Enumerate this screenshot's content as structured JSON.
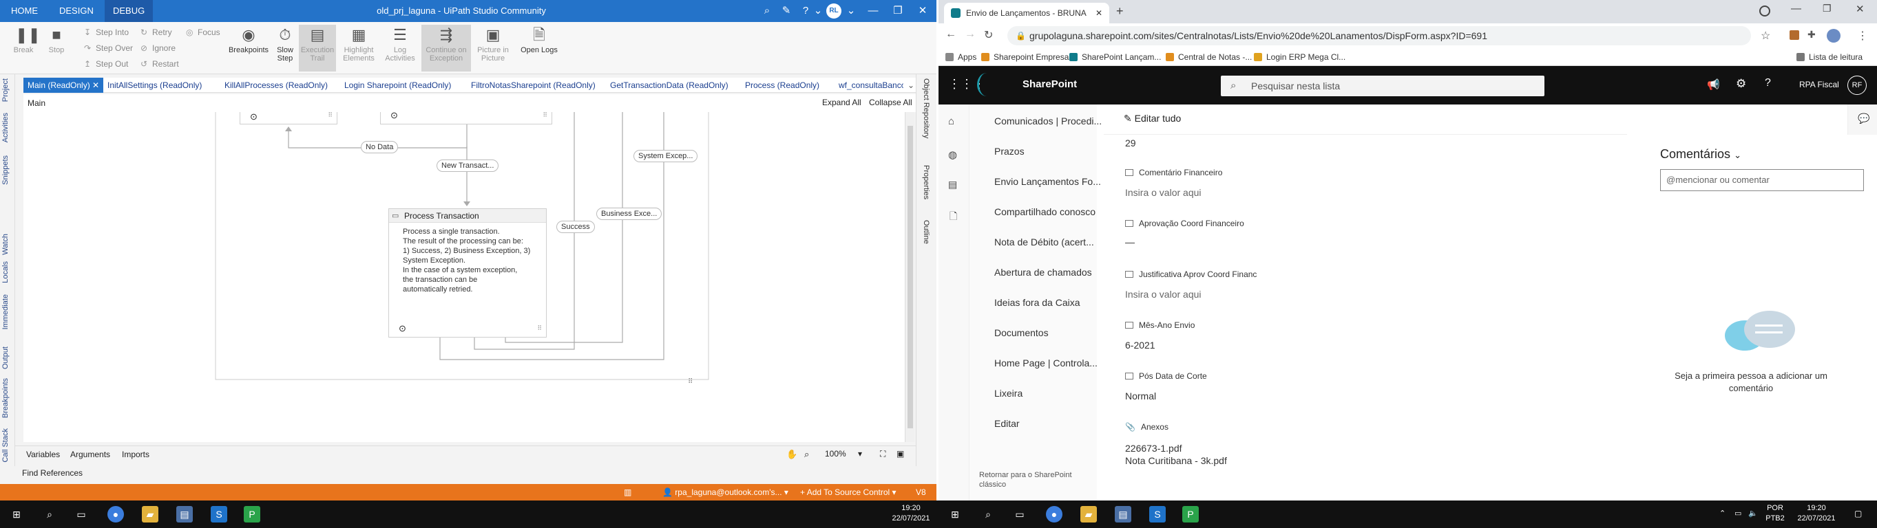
{
  "uipath": {
    "ribbon_tabs": [
      "HOME",
      "DESIGN",
      "DEBUG"
    ],
    "window_title": "old_prj_laguna - UiPath Studio Community",
    "avatar": "RL",
    "ribbon": {
      "break": "Break",
      "stop": "Stop",
      "step_into": "Step Into",
      "step_over": "Step Over",
      "step_out": "Step Out",
      "retry": "Retry",
      "ignore": "Ignore",
      "restart": "Restart",
      "focus": "Focus",
      "breakpoints": "Breakpoints",
      "slow_step": "Slow Step",
      "execution_trail": "Execution Trail",
      "highlight_elements": "Highlight Elements",
      "log_activities": "Log Activities",
      "continue_on_exception": "Continue on Exception",
      "picture_in_picture": "Picture in Picture",
      "open_logs": "Open Logs"
    },
    "doc_tabs": [
      "Main (ReadOnly)",
      "InitAllSettings (ReadOnly)",
      "KillAllProcesses (ReadOnly)",
      "Login Sharepoint (ReadOnly)",
      "FiltroNotasSharepoint (ReadOnly)",
      "GetTransactionData (ReadOnly)",
      "Process (ReadOnly)",
      "wf_consultaBanco"
    ],
    "left_panels": [
      "Project",
      "Activities",
      "Snippets",
      "Watch",
      "Locals",
      "Immediate",
      "Output",
      "Breakpoints",
      "Call Stack"
    ],
    "right_panels": [
      "Object Repository",
      "Properties",
      "Outline"
    ],
    "breadcrumb": "Main",
    "expand_all": "Expand All",
    "collapse_all": "Collapse All",
    "canvas": {
      "no_data": "No Data",
      "new_transaction": "New Transact...",
      "system_exception": "System Excep...",
      "business_exception": "Business Exce...",
      "success": "Success",
      "process_title": "Process Transaction",
      "process_desc_1": "Process a single transaction.",
      "process_desc_2": "The result of the processing can be:",
      "process_desc_3": "1) Success, 2) Business Exception, 3)",
      "process_desc_4": "System Exception.",
      "process_desc_5": "In the case of a system exception,",
      "process_desc_6": "the transaction can be",
      "process_desc_7": "automatically retried."
    },
    "bottom_tabs": [
      "Variables",
      "Arguments",
      "Imports"
    ],
    "zoom": "100%",
    "find_references": "Find References",
    "status": {
      "account": "rpa_laguna@outlook.com's...",
      "source_control": "Add To Source Control",
      "version": "V8"
    }
  },
  "chrome": {
    "tab_title": "Envio de Lançamentos - BRUNA",
    "url": "grupolaguna.sharepoint.com/sites/Centralnotas/Lists/Envio%20de%20Lanamentos/DispForm.aspx?ID=691",
    "bookmarks": [
      "Apps",
      "Sharepoint Empresas",
      "SharePoint Lançam...",
      "Central de Notas -...",
      "Login ERP Mega Cl..."
    ],
    "reading_list": "Lista de leitura"
  },
  "sharepoint": {
    "brand": "SharePoint",
    "search_placeholder": "Pesquisar nesta lista",
    "user_name": "RPA Fiscal",
    "user_initials": "RF",
    "nav": [
      "Comunicados | Procedi...",
      "Prazos",
      "Envio Lançamentos Fo...",
      "Compartilhado conosco",
      "Nota de Débito (acert...",
      "Abertura de chamados",
      "Ideias fora da Caixa",
      "Documentos",
      "Home Page | Controla...",
      "Lixeira",
      "Editar"
    ],
    "return_classic_1": "Retornar para o SharePoint",
    "return_classic_2": "clássico",
    "edit_all": "Editar tudo",
    "top_value": "29",
    "fields": [
      {
        "label": "Comentário Financeiro",
        "value": "Insira o valor aqui"
      },
      {
        "label": "Aprovação Coord Financeiro",
        "value": "—"
      },
      {
        "label": "Justificativa Aprov Coord Financ",
        "value": "Insira o valor aqui"
      },
      {
        "label": "Mês-Ano Envio",
        "value": "6-2021"
      },
      {
        "label": "Pós Data de Corte",
        "value": "Normal"
      },
      {
        "label": "Anexos",
        "value": "226673-1.pdf"
      }
    ],
    "attachment_2": "Nota Curitibana - 3k.pdf",
    "comments_title": "Comentários",
    "comment_placeholder": "@mencionar ou comentar",
    "empty_comments_1": "Seja a primeira pessoa a adicionar um",
    "empty_comments_2": "comentário"
  },
  "taskbar": {
    "left_time": "19:20",
    "left_date": "22/07/2021",
    "right_lang_1": "POR",
    "right_lang_2": "PTB2",
    "right_time": "19:20",
    "right_date": "22/07/2021"
  },
  "colors": {
    "uipath_blue": "#2473c9",
    "status_orange": "#e8741c",
    "sharepoint_bar": "#111111",
    "taskbar": "#111111"
  }
}
